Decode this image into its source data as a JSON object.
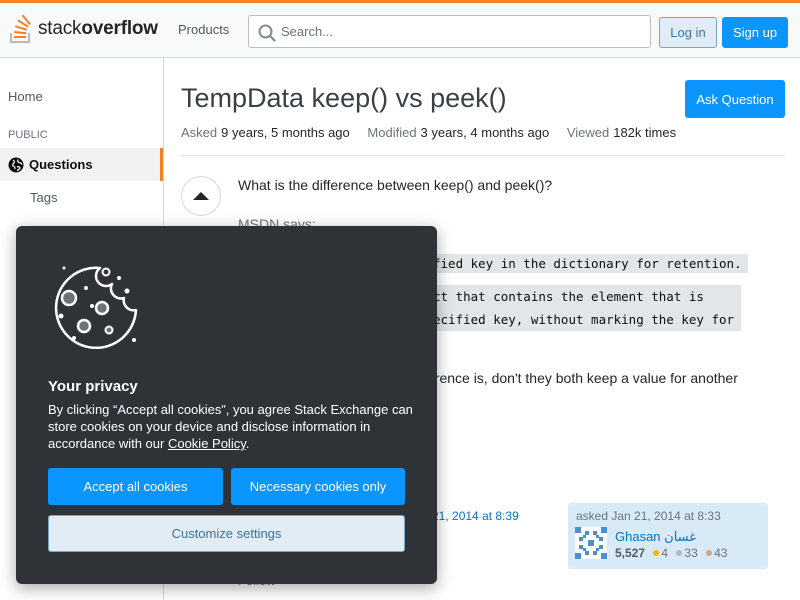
{
  "header": {
    "logo_text_light": "stack",
    "logo_text_bold": "overflow",
    "products_label": "Products",
    "search_placeholder": "Search...",
    "login_label": "Log in",
    "signup_label": "Sign up"
  },
  "sidebar": {
    "home_label": "Home",
    "public_label": "PUBLIC",
    "questions_label": "Questions",
    "tags_label": "Tags"
  },
  "question": {
    "title": "TempData keep() vs peek()",
    "ask_button": "Ask Question",
    "asked_label": "Asked",
    "asked_value": "9 years, 5 months ago",
    "modified_label": "Modified",
    "modified_value": "3 years, 4 months ago",
    "viewed_label": "Viewed",
    "viewed_value": "182k times",
    "line1": "What is the difference between keep() and peek()?",
    "line2": "MSDN says:",
    "code1": "fied key in the dictionary for retention.",
    "code2a": "ct that contains the element that is",
    "code2b": "ecified key, without marking the key for",
    "line3": "erence is, don't they both keep a value for another",
    "edited_fragment": "21, 2014 at 8:39",
    "follow_fragment": "Follow"
  },
  "asker": {
    "asked_time": "asked Jan 21, 2014 at 8:33",
    "name": "Ghasan غسان",
    "reputation": "5,527",
    "gold": "4",
    "silver": "33",
    "bronze": "43",
    "gold_color": "#f1b600",
    "silver_color": "#b4b8bc",
    "bronze_color": "#d1a684"
  },
  "cookie": {
    "title": "Your privacy",
    "text_before_link": "By clicking “Accept all cookies”, you agree Stack Exchange can store cookies on your device and disclose information in accordance with our ",
    "link_text": "Cookie Policy",
    "text_after_link": ".",
    "accept_label": "Accept all cookies",
    "necessary_label": "Necessary cookies only",
    "customize_label": "Customize settings"
  },
  "colors": {
    "accent_orange": "#f48225",
    "primary_blue": "#0a95ff",
    "modal_bg": "#2f3337"
  }
}
